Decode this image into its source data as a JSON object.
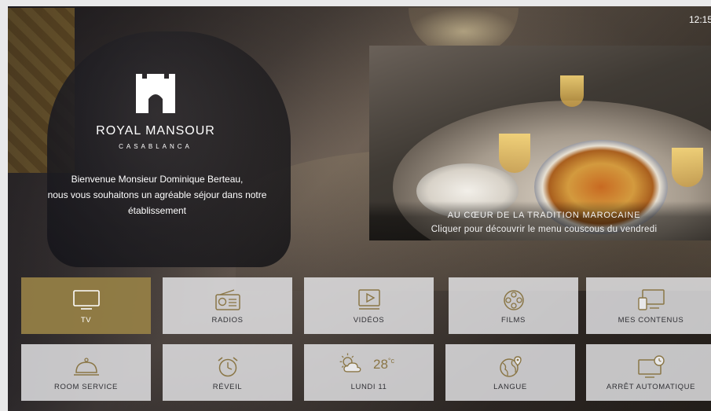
{
  "clock": "12:15",
  "brand": {
    "name": "ROYAL MANSOUR",
    "city": "CASABLANCA"
  },
  "welcome": {
    "line1": "Bienvenue Monsieur Dominique Berteau,",
    "line2": "nous vous souhaitons un agréable séjour dans notre",
    "line3": "établissement"
  },
  "promo": {
    "title": "AU CŒUR DE LA TRADITION MAROCAINE",
    "subtitle": "Cliquer pour découvrir le menu couscous du vendredi"
  },
  "tiles_row1": [
    {
      "label": "TV",
      "icon": "tv-icon",
      "active": true
    },
    {
      "label": "RADIOS",
      "icon": "radio-icon"
    },
    {
      "label": "VIDÉOS",
      "icon": "video-play-icon"
    },
    {
      "label": "FILMS",
      "icon": "film-reel-icon"
    },
    {
      "label": "MES CONTENUS",
      "icon": "devices-icon"
    }
  ],
  "tiles_row2": [
    {
      "label": "ROOM SERVICE",
      "icon": "room-service-bell-icon"
    },
    {
      "label": "RÉVEIL",
      "icon": "alarm-clock-icon"
    },
    {
      "label": "LUNDI 11",
      "icon": "weather-partly-sunny-icon",
      "temperature": "28",
      "unit": "°c"
    },
    {
      "label": "LANGUE",
      "icon": "globe-location-icon"
    },
    {
      "label": "ARRÊT AUTOMATIQUE",
      "icon": "screen-timer-icon"
    }
  ],
  "colors": {
    "active_tile": "#96804a",
    "tile_bg": "#e8e8ea",
    "text_dark": "#303035"
  }
}
